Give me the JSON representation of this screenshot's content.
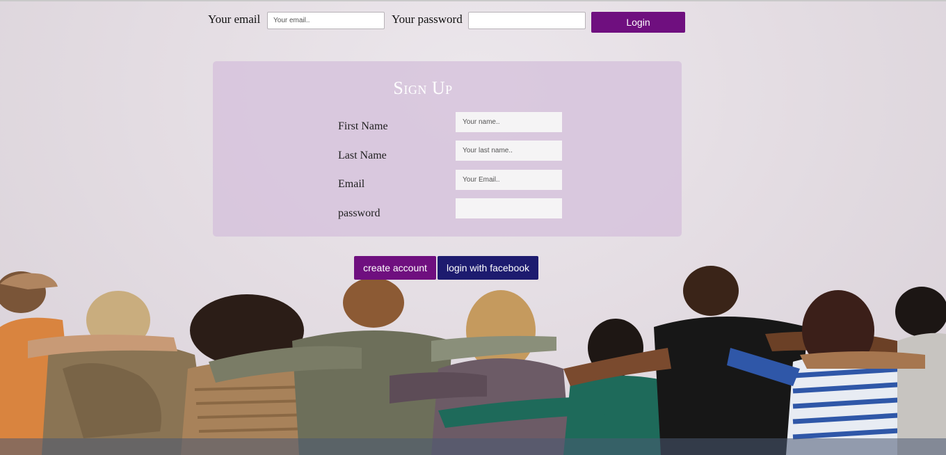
{
  "login_bar": {
    "email_label": "Your email",
    "email_placeholder": "Your email..",
    "password_label": "Your password",
    "password_placeholder": "",
    "login_button": "Login"
  },
  "signup": {
    "title": "Sign Up",
    "fields": [
      {
        "label": "First Name",
        "placeholder": "Your name.."
      },
      {
        "label": "Last Name",
        "placeholder": "Your last name.."
      },
      {
        "label": "Email",
        "placeholder": "Your Email.."
      },
      {
        "label": "password",
        "placeholder": ""
      }
    ]
  },
  "actions": {
    "create_account": "create account",
    "login_facebook": "login with facebook"
  },
  "colors": {
    "primary_purple": "#6f0f7f",
    "facebook_navy": "#1d1b6f",
    "card_background": "#d6c2dc"
  }
}
